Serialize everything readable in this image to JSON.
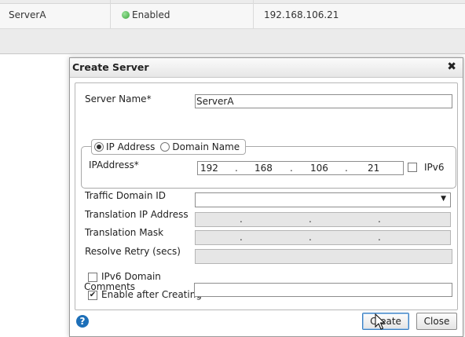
{
  "background_table": {
    "row": {
      "name": "ServerA",
      "state": "Enabled",
      "ip": "192.168.106.21"
    },
    "colors": {
      "enabled_dot": "#3aa53a"
    }
  },
  "dialog": {
    "title": "Create Server",
    "close_icon": "close-icon",
    "server_name": {
      "label": "Server Name*",
      "value": "ServerA"
    },
    "address_type": {
      "options": [
        "IP Address",
        "Domain Name"
      ],
      "selected": "IP Address"
    },
    "ip_address": {
      "label": "IPAddress*",
      "octets": [
        "192",
        "168",
        "106",
        "21"
      ],
      "separator": ".",
      "ipv6_label": "IPv6",
      "ipv6_checked": false
    },
    "traffic_domain": {
      "label": "Traffic Domain ID",
      "value": "",
      "arrow": "▼"
    },
    "translation_ip": {
      "label": "Translation IP Address",
      "separator": "."
    },
    "translation_mask": {
      "label": "Translation Mask",
      "separator": "."
    },
    "resolve_retry": {
      "label": "Resolve Retry (secs)"
    },
    "ipv6_domain": {
      "label": "IPv6 Domain",
      "checked": false
    },
    "enable_after_creating": {
      "label": "Enable after Creating",
      "checked": true,
      "mark": "✔"
    },
    "comments": {
      "label": "Comments",
      "value": ""
    },
    "help": {
      "icon": "help-icon",
      "glyph": "?"
    },
    "buttons": {
      "create": "Create",
      "close": "Close"
    },
    "colors": {
      "help_blue": "#1d6fb8",
      "focus_border": "#3c7fc1"
    }
  }
}
